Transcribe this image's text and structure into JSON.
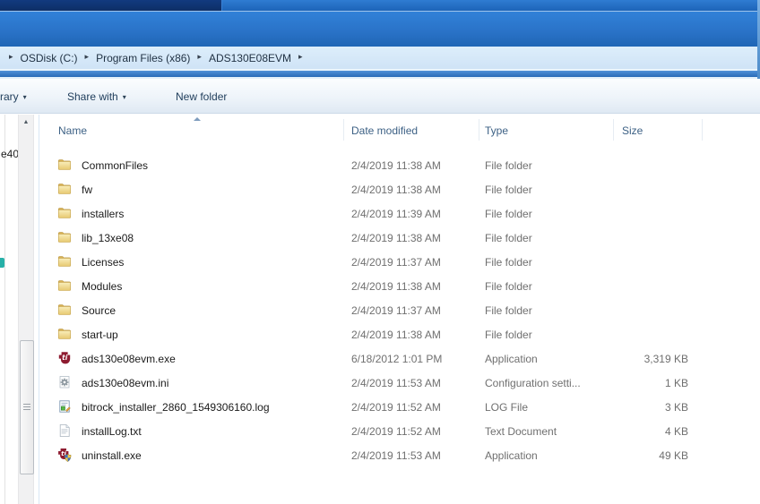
{
  "window": {
    "breadcrumb": {
      "separator": "▸",
      "items": [
        "OSDisk (C:)",
        "Program Files (x86)",
        "ADS130E08EVM"
      ]
    },
    "toolbar": {
      "dropdown_glyph": "▾",
      "items": [
        {
          "label": "rary",
          "has_dropdown": true,
          "note": "clipped at left edge"
        },
        {
          "label": "Share with",
          "has_dropdown": true
        },
        {
          "label": "New folder",
          "has_dropdown": false
        }
      ]
    }
  },
  "navpane": {
    "clipped_text": "e40"
  },
  "scrollbar": {
    "up_glyph": "▲"
  },
  "list": {
    "columns": [
      {
        "label": "Name",
        "sorted": "ascending"
      },
      {
        "label": "Date modified"
      },
      {
        "label": "Type"
      },
      {
        "label": "Size"
      }
    ],
    "rows": [
      {
        "icon": "folder-icon",
        "name": "CommonFiles",
        "date": "2/4/2019 11:38 AM",
        "type": "File folder",
        "size": ""
      },
      {
        "icon": "folder-icon",
        "name": "fw",
        "date": "2/4/2019 11:38 AM",
        "type": "File folder",
        "size": ""
      },
      {
        "icon": "folder-icon",
        "name": "installers",
        "date": "2/4/2019 11:39 AM",
        "type": "File folder",
        "size": ""
      },
      {
        "icon": "folder-icon",
        "name": "lib_13xe08",
        "date": "2/4/2019 11:38 AM",
        "type": "File folder",
        "size": ""
      },
      {
        "icon": "folder-icon",
        "name": "Licenses",
        "date": "2/4/2019 11:37 AM",
        "type": "File folder",
        "size": ""
      },
      {
        "icon": "folder-icon",
        "name": "Modules",
        "date": "2/4/2019 11:38 AM",
        "type": "File folder",
        "size": ""
      },
      {
        "icon": "folder-icon",
        "name": "Source",
        "date": "2/4/2019 11:37 AM",
        "type": "File folder",
        "size": ""
      },
      {
        "icon": "folder-icon",
        "name": "start-up",
        "date": "2/4/2019 11:38 AM",
        "type": "File folder",
        "size": ""
      },
      {
        "icon": "ti-logo-icon",
        "name": "ads130e08evm.exe",
        "date": "6/18/2012 1:01 PM",
        "type": "Application",
        "size": "3,319 KB"
      },
      {
        "icon": "gear-settings-icon",
        "name": "ads130e08evm.ini",
        "date": "2/4/2019 11:53 AM",
        "type": "Configuration setti...",
        "size": "1 KB"
      },
      {
        "icon": "log-file-icon",
        "name": "bitrock_installer_2860_1549306160.log",
        "date": "2/4/2019 11:52 AM",
        "type": "LOG File",
        "size": "3 KB"
      },
      {
        "icon": "text-document-icon",
        "name": "installLog.txt",
        "date": "2/4/2019 11:52 AM",
        "type": "Text Document",
        "size": "4 KB"
      },
      {
        "icon": "ti-logo-shield-icon",
        "name": "uninstall.exe",
        "date": "2/4/2019 11:53 AM",
        "type": "Application",
        "size": "49 KB"
      }
    ]
  },
  "colors": {
    "titlebar-navy": "#0d2f66",
    "aero-blue": "#2a73c8",
    "address-bg": "#d5e7f7",
    "breadcrumb-text": "#1f3042",
    "toolbar-text": "#1e3c5a",
    "header-text": "#3d6185",
    "row-text": "#1a1a1a",
    "secondary-text": "#6f6f6f",
    "folder-yellow": "#efd27a",
    "ti-red": "#8e1b30",
    "teal-mark": "#27b0a8"
  }
}
